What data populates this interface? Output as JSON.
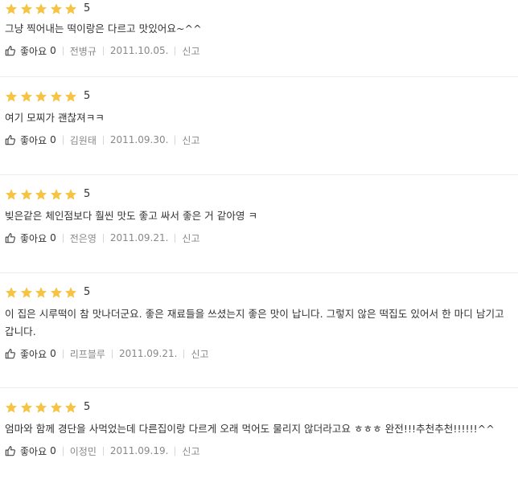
{
  "labels": {
    "like": "좋아요",
    "report": "신고"
  },
  "colors": {
    "star": "#f6c343",
    "text": "#333333",
    "meta": "#888888"
  },
  "reviews": [
    {
      "stars": 5,
      "score": "5",
      "text": "그냥 찍어내는 떡이랑은 다르고 맛있어요~^^",
      "likes": "0",
      "author": "전병규",
      "date": "2011.10.05."
    },
    {
      "stars": 5,
      "score": "5",
      "text": "여기 모찌가 괜찮져ㅋㅋ",
      "likes": "0",
      "author": "김원태",
      "date": "2011.09.30."
    },
    {
      "stars": 5,
      "score": "5",
      "text": "빚은같은 체인점보다 훨씬 맛도 좋고 싸서 좋은 거 같아영 ㅋ",
      "likes": "0",
      "author": "전은영",
      "date": "2011.09.21."
    },
    {
      "stars": 5,
      "score": "5",
      "text": "이 집은 시루떡이 참 맛나더군요. 좋은 재료들을 쓰셨는지 좋은 맛이 납니다. 그렇지 않은 떡집도 있어서 한 마디 남기고 갑니다.",
      "likes": "0",
      "author": "리프블루",
      "date": "2011.09.21."
    },
    {
      "stars": 5,
      "score": "5",
      "text": "엄마와 함께 경단을 사먹었는데 다른집이랑 다르게 오래 먹어도 물리지 않더라고요 ㅎㅎㅎ 완전!!!추천추천!!!!!!^^",
      "likes": "0",
      "author": "이정민",
      "date": "2011.09.19."
    }
  ]
}
